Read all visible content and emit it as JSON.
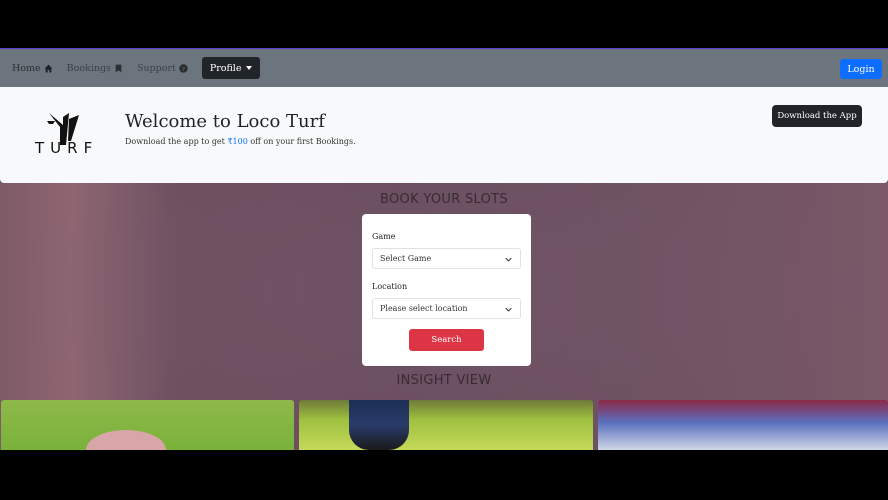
{
  "nav": {
    "home": "Home",
    "bookings": "Bookings",
    "support": "Support",
    "profile": "Profile",
    "login": "Login"
  },
  "banner": {
    "logo_text": "TURF",
    "title": "Welcome to Loco Turf",
    "promo_prefix": "Download the app to get ",
    "promo_amount": "₹100",
    "promo_suffix": " off on your first Bookings.",
    "download_button": "Download the App"
  },
  "booking": {
    "section_title": "BOOK YOUR SLOTS",
    "game_label": "Game",
    "game_value": "Select Game",
    "location_label": "Location",
    "location_value": "Please select location",
    "search_button": "Search"
  },
  "insight": {
    "section_title": "INSIGHT VIEW"
  },
  "colors": {
    "navbar": "#6c757d",
    "primary": "#0d6efd",
    "danger": "#dc3545",
    "dark": "#212529"
  },
  "icons": {
    "home": "house-icon",
    "bookings": "bookmark-icon",
    "support": "question-circle-icon",
    "dropdown": "chevron-down-icon"
  }
}
